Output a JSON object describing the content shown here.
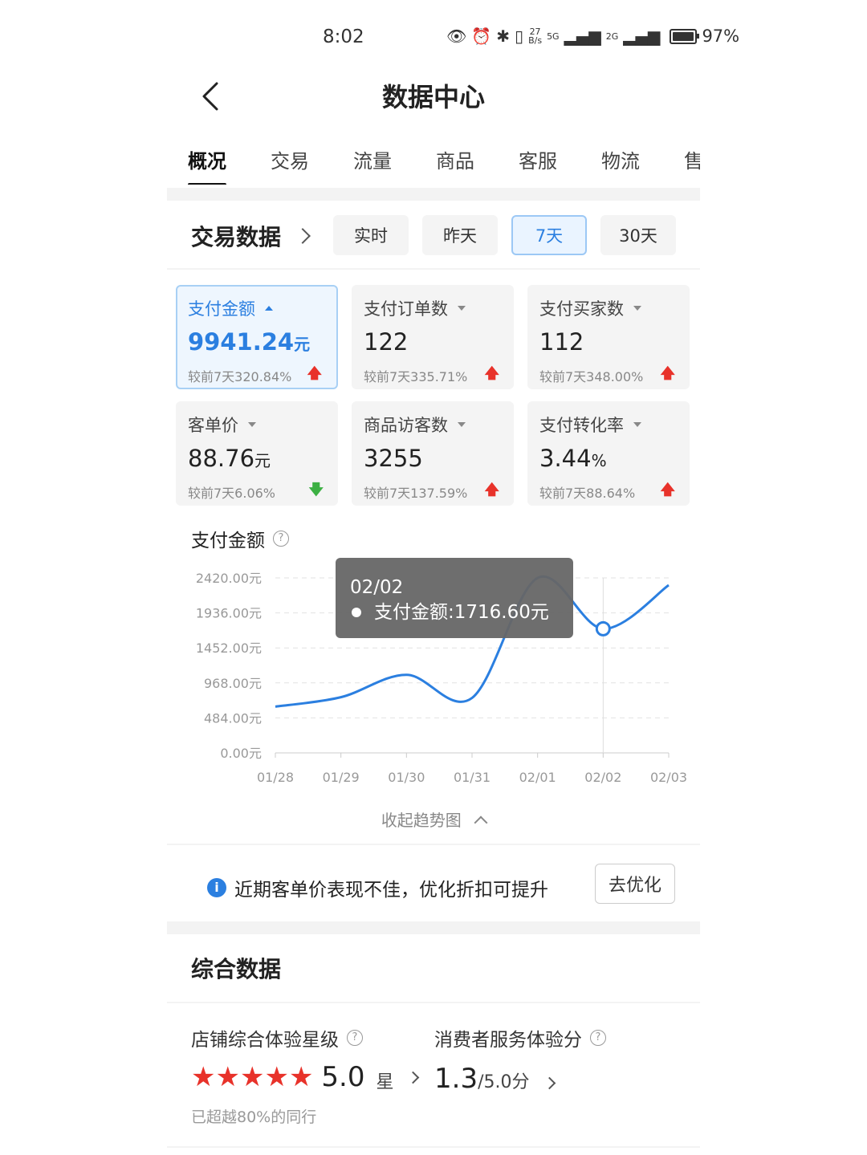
{
  "status_bar": {
    "time": "8:02",
    "net_speed_top": "27",
    "net_speed_bottom": "B/s",
    "sim1": "5G",
    "sim2": "2G",
    "battery": "97%",
    "battery_level": 0.97,
    "icons": [
      "eye-icon",
      "alarm-icon",
      "bluetooth-icon",
      "vibrate-icon",
      "signal-icon",
      "battery-icon"
    ]
  },
  "header": {
    "title": "数据中心",
    "back_icon": "chevron-left-icon"
  },
  "tabs": [
    {
      "label": "概况",
      "active": true
    },
    {
      "label": "交易"
    },
    {
      "label": "流量"
    },
    {
      "label": "商品"
    },
    {
      "label": "客服"
    },
    {
      "label": "物流"
    },
    {
      "label": "售"
    }
  ],
  "trade": {
    "title": "交易数据",
    "ranges": [
      {
        "label": "实时"
      },
      {
        "label": "昨天"
      },
      {
        "label": "7天",
        "selected": true
      },
      {
        "label": "30天"
      }
    ]
  },
  "metrics": [
    {
      "label": "支付金额",
      "value": "9941.24",
      "unit": "元",
      "compare": "较前7天320.84%",
      "trend": "up",
      "selected": true
    },
    {
      "label": "支付订单数",
      "value": "122",
      "unit": "",
      "compare": "较前7天335.71%",
      "trend": "up"
    },
    {
      "label": "支付买家数",
      "value": "112",
      "unit": "",
      "compare": "较前7天348.00%",
      "trend": "up"
    },
    {
      "label": "客单价",
      "value": "88.76",
      "unit": "元",
      "compare": "较前7天6.06%",
      "trend": "down"
    },
    {
      "label": "商品访客数",
      "value": "3255",
      "unit": "",
      "compare": "较前7天137.59%",
      "trend": "up"
    },
    {
      "label": "支付转化率",
      "value": "3.44",
      "unit": "%",
      "compare": "较前7天88.64%",
      "trend": "up"
    }
  ],
  "colors": {
    "accent": "#2b7fe0",
    "up": "#e8322a",
    "down": "#3cb043",
    "tooltip_bg": "#666666"
  },
  "chart_title": "支付金额",
  "chart_data": {
    "type": "line",
    "x": [
      "01/28",
      "01/29",
      "01/30",
      "01/31",
      "02/01",
      "02/02",
      "02/03"
    ],
    "series": [
      {
        "values": [
          640,
          770,
          1080,
          760,
          2420,
          1716.6,
          2320
        ]
      }
    ],
    "yticks": [
      "2420.00元",
      "1936.00元",
      "1452.00元",
      "968.00元",
      "484.00元",
      "0.00元"
    ],
    "ylim": [
      0,
      2420
    ],
    "grid": true,
    "tooltip": {
      "date": "02/02",
      "text": "支付金额:1716.60元"
    },
    "highlight_index": 5
  },
  "collapse_label": "收起趋势图",
  "notice": {
    "text": "近期客单价表现不佳，优化折扣可提升",
    "button": "去优化"
  },
  "summary": {
    "title": "综合数据",
    "store_rating_label": "店铺综合体验星级",
    "stars": 5,
    "rating_value": "5.0",
    "rating_unit": "星",
    "exceed_text": "已超越80%的同行",
    "service_label": "消费者服务体验分",
    "service_value": "1.3",
    "service_total": "/5.0分"
  }
}
